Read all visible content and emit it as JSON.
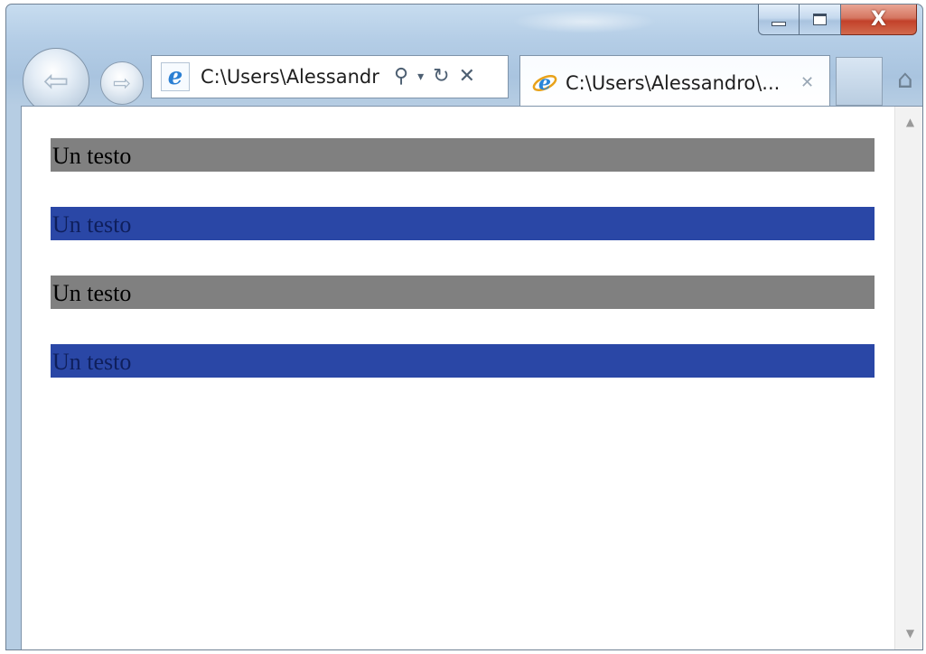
{
  "browser": {
    "address_bar": {
      "url_text": "C:\\Users\\Alessandr",
      "search_glyph": "⚲",
      "dropdown_glyph": "▾",
      "refresh_glyph": "↻",
      "stop_glyph": "✕"
    },
    "tabs": [
      {
        "title": "C:\\Users\\Alessandro\\...",
        "close_glyph": "✕",
        "icon": "ie-logo-icon"
      }
    ],
    "caption": {
      "minimize_icon": "minimize-icon",
      "maximize_icon": "maximize-icon",
      "close_glyph": "X"
    },
    "nav": {
      "back_glyph": "⇦",
      "forward_glyph": "⇨"
    },
    "home_glyph": "⌂",
    "favicon_letter": "e"
  },
  "page": {
    "bars": [
      {
        "text": "Un testo",
        "style": "gray"
      },
      {
        "text": "Un testo",
        "style": "blue"
      },
      {
        "text": "Un testo",
        "style": "gray"
      },
      {
        "text": "Un testo",
        "style": "blue"
      }
    ],
    "colors": {
      "gray": "#808080",
      "blue": "#2a47a6",
      "blue_text": "#0f1f5c"
    }
  },
  "scrollbar": {
    "up_glyph": "▲",
    "down_glyph": "▼"
  }
}
